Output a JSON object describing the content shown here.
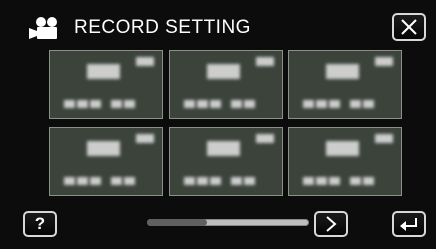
{
  "header": {
    "title": "RECORD SETTING",
    "mode_icon": "video-camera-icon"
  },
  "controls": {
    "close_icon": "close-icon",
    "help_label": "?",
    "next_icon": "chevron-right-icon",
    "back_icon": "return-icon"
  },
  "grid": {
    "rows": 2,
    "columns": 3,
    "items": [
      {
        "state": "blurred"
      },
      {
        "state": "blurred"
      },
      {
        "state": "blurred"
      },
      {
        "state": "blurred"
      },
      {
        "state": "blurred"
      },
      {
        "state": "blurred"
      }
    ]
  },
  "scrollbar": {
    "position_fraction": 0.0,
    "visible_fraction": 0.37
  },
  "colors": {
    "background": "#0c0c0c",
    "tile": "#3b433b",
    "tile_border": "#8a918a",
    "text": "#ffffff"
  }
}
